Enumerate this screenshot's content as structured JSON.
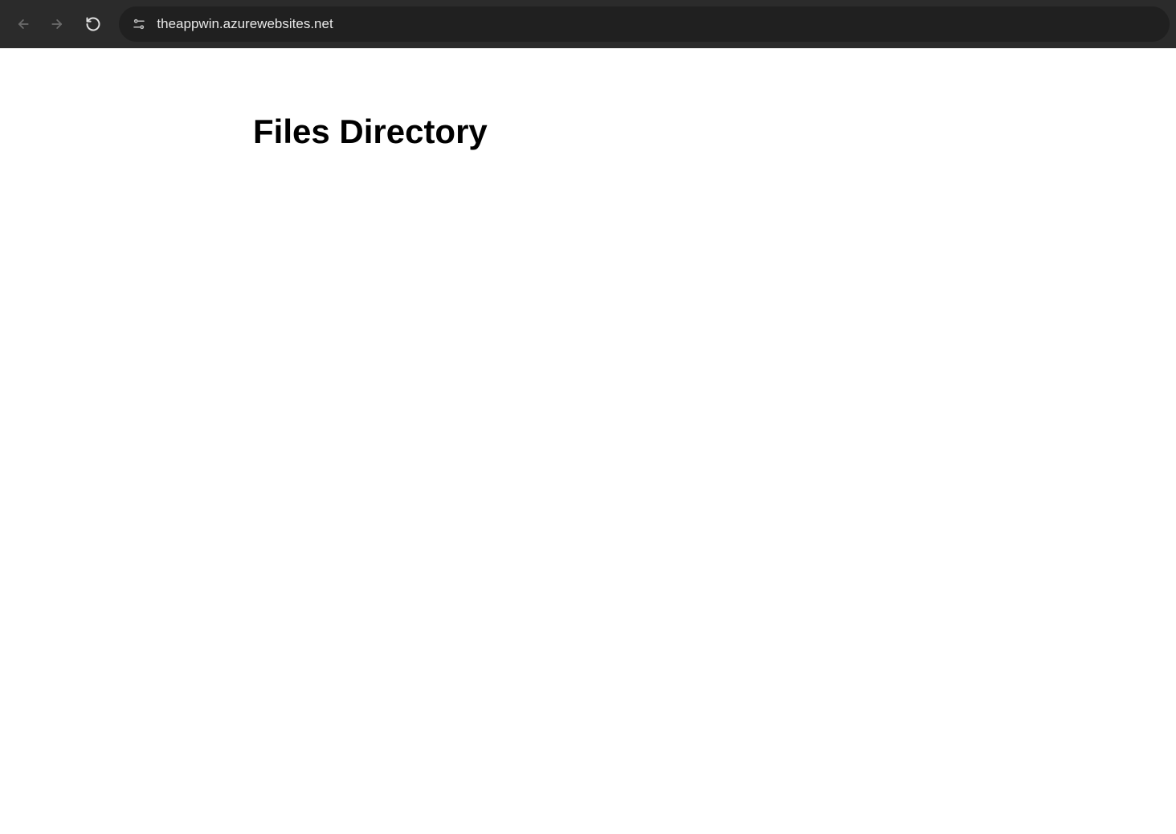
{
  "browser": {
    "url": "theappwin.azurewebsites.net"
  },
  "page": {
    "title": "Files Directory"
  }
}
